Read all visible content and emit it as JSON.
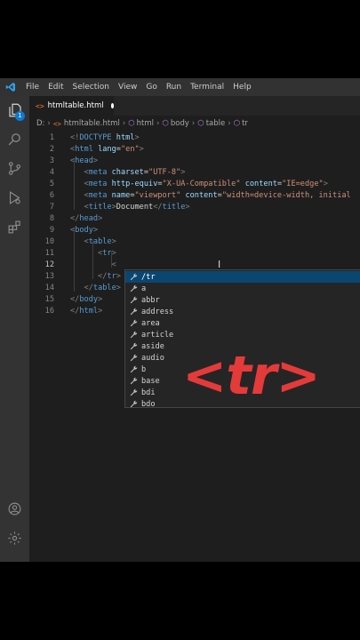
{
  "menu": {
    "items": [
      "File",
      "Edit",
      "Selection",
      "View",
      "Go",
      "Run",
      "Terminal",
      "Help"
    ]
  },
  "activity": {
    "explorer_badge": "1"
  },
  "tab": {
    "filename": "htmltable.html"
  },
  "breadcrumb": {
    "drive": "D:",
    "file": "htmltable.html",
    "items": [
      "html",
      "body",
      "table",
      "tr"
    ]
  },
  "editor": {
    "line_numbers": [
      "1",
      "2",
      "3",
      "4",
      "5",
      "6",
      "7",
      "8",
      "9",
      "10",
      "11",
      "12",
      "13",
      "14",
      "15",
      "16"
    ],
    "current_line": "12",
    "typed": "<"
  },
  "suggestions": {
    "items": [
      "/tr",
      "a",
      "abbr",
      "address",
      "area",
      "article",
      "aside",
      "audio",
      "b",
      "base",
      "bdi",
      "bdo"
    ],
    "selected": "/tr"
  },
  "overlay": {
    "text": "<tr>"
  },
  "colors": {
    "accent": "#0e7ad3",
    "overlay_red": "#e53a3a",
    "selection": "#094771"
  }
}
